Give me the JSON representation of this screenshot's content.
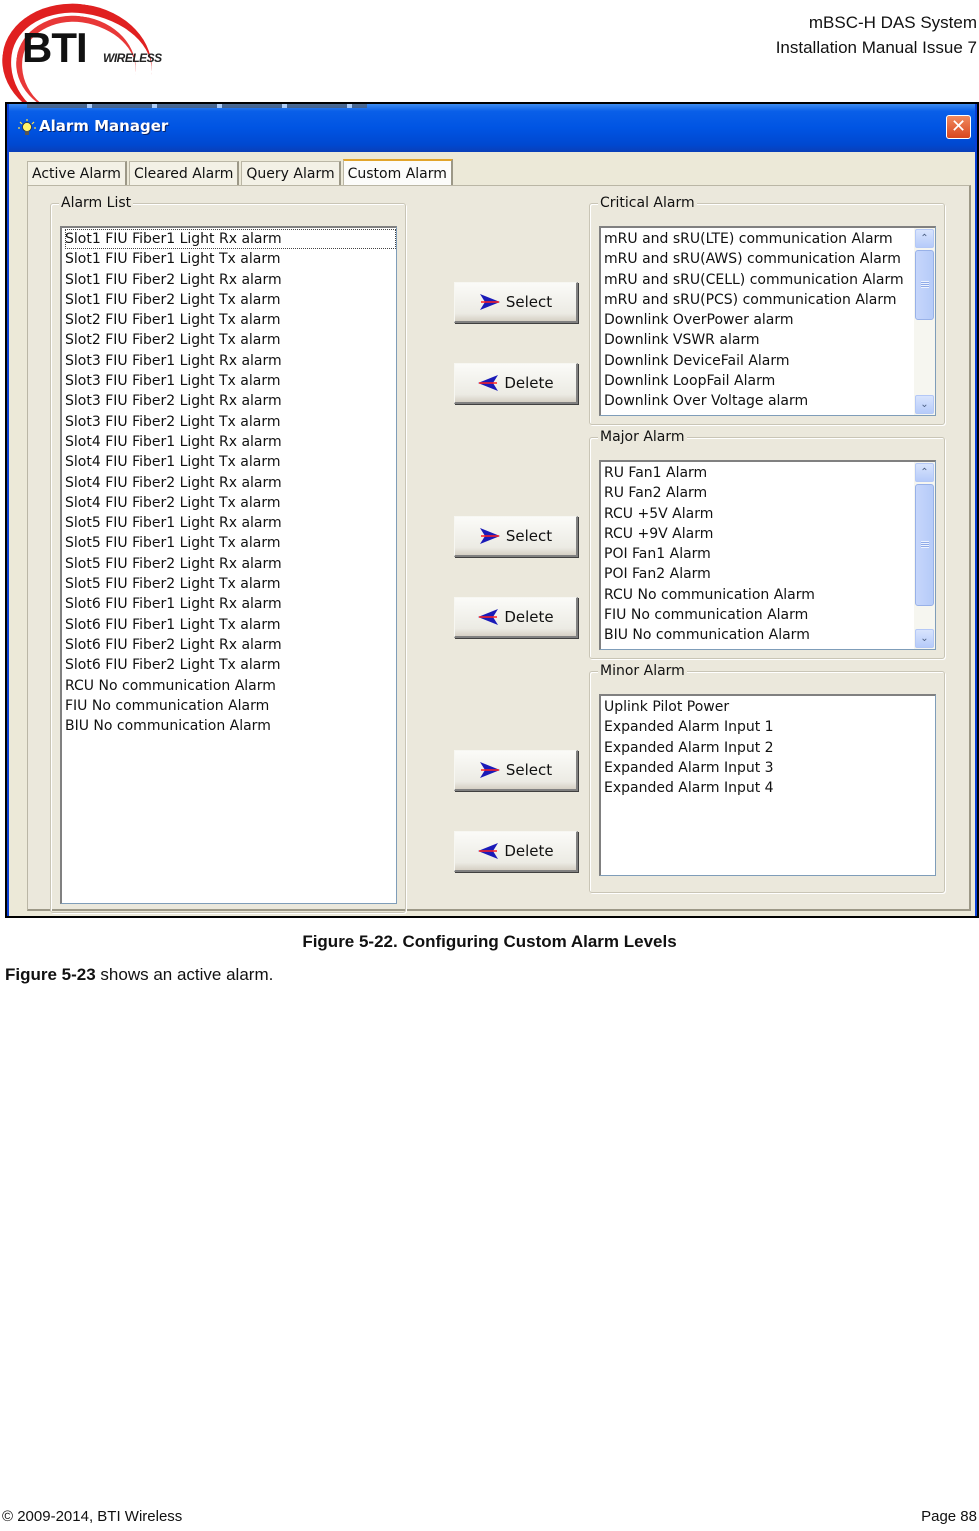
{
  "document": {
    "logo": {
      "brand": "BTI",
      "sub": "WIRELESS"
    },
    "header": {
      "line1": "mBSC-H DAS System",
      "line2": "Installation Manual Issue 7"
    },
    "figure_caption": "Figure 5-22. Configuring Custom Alarm Levels",
    "body": {
      "ref": "Figure 5-23",
      "text": " shows an active alarm."
    },
    "footer": {
      "copyright": "© 2009-2014, BTI Wireless",
      "page": "Page 88"
    }
  },
  "window": {
    "title": "Alarm Manager",
    "icon": "lightbulb-icon",
    "close_icon": "close-icon",
    "close_glyph": "✕",
    "tabs": [
      {
        "label": "Active Alarm",
        "active": false
      },
      {
        "label": "Cleared Alarm",
        "active": false
      },
      {
        "label": "Query Alarm",
        "active": false
      },
      {
        "label": "Custom Alarm",
        "active": true
      }
    ],
    "alarm_list": {
      "label": "Alarm List",
      "items": [
        "Slot1 FIU Fiber1 Light Rx alarm",
        "Slot1 FIU Fiber1 Light Tx alarm",
        "Slot1 FIU Fiber2 Light Rx alarm",
        "Slot1 FIU Fiber2 Light Tx alarm",
        "Slot2 FIU Fiber1 Light Tx alarm",
        "Slot2 FIU Fiber2 Light Tx alarm",
        "Slot3 FIU Fiber1 Light Rx alarm",
        "Slot3 FIU Fiber1 Light Tx alarm",
        "Slot3 FIU Fiber2 Light Rx alarm",
        "Slot3 FIU Fiber2 Light Tx alarm",
        "Slot4 FIU Fiber1 Light Rx alarm",
        "Slot4 FIU Fiber1 Light Tx alarm",
        "Slot4 FIU Fiber2 Light Rx alarm",
        "Slot4 FIU Fiber2 Light Tx alarm",
        "Slot5 FIU Fiber1 Light Rx alarm",
        "Slot5 FIU Fiber1 Light Tx alarm",
        "Slot5 FIU Fiber2 Light Rx alarm",
        "Slot5 FIU Fiber2 Light Tx alarm",
        "Slot6 FIU Fiber1 Light Rx alarm",
        "Slot6 FIU Fiber1 Light Tx alarm",
        "Slot6 FIU Fiber2 Light Rx alarm",
        "Slot6 FIU Fiber2 Light Tx alarm",
        "RCU No communication Alarm",
        "FIU No communication Alarm",
        "BIU No communication Alarm"
      ],
      "focused_index": 0
    },
    "critical": {
      "label": "Critical Alarm",
      "items": [
        "mRU and sRU(LTE) communication Alarm",
        "mRU and sRU(AWS) communication Alarm",
        "mRU and sRU(CELL) communication Alarm",
        "mRU and sRU(PCS) communication Alarm",
        "Downlink OverPower alarm",
        "Downlink VSWR alarm",
        "Downlink DeviceFail Alarm",
        "Downlink LoopFail Alarm",
        "Downlink Over Voltage alarm"
      ]
    },
    "major": {
      "label": "Major Alarm",
      "items": [
        "RU Fan1 Alarm",
        "RU Fan2 Alarm",
        "RCU +5V Alarm",
        "RCU +9V Alarm",
        "POI Fan1 Alarm",
        "POI Fan2 Alarm",
        "RCU No communication Alarm",
        "FIU No communication Alarm",
        "BIU No communication Alarm"
      ]
    },
    "minor": {
      "label": "Minor Alarm",
      "items": [
        "Uplink Pilot Power",
        "Expanded Alarm Input 1",
        "Expanded Alarm Input 2",
        "Expanded Alarm Input 3",
        "Expanded Alarm Input 4"
      ]
    },
    "buttons": {
      "select_label": "Select",
      "delete_label": "Delete"
    },
    "scroll_glyphs": {
      "up": "⌃",
      "down": "⌄"
    },
    "colors": {
      "titlebar": "#0054e3",
      "dialog_bg": "#ece9d8",
      "arrow_blue": "#1a1ab8",
      "arrow_red": "#ff2020",
      "logo_red": "#e02020"
    }
  }
}
